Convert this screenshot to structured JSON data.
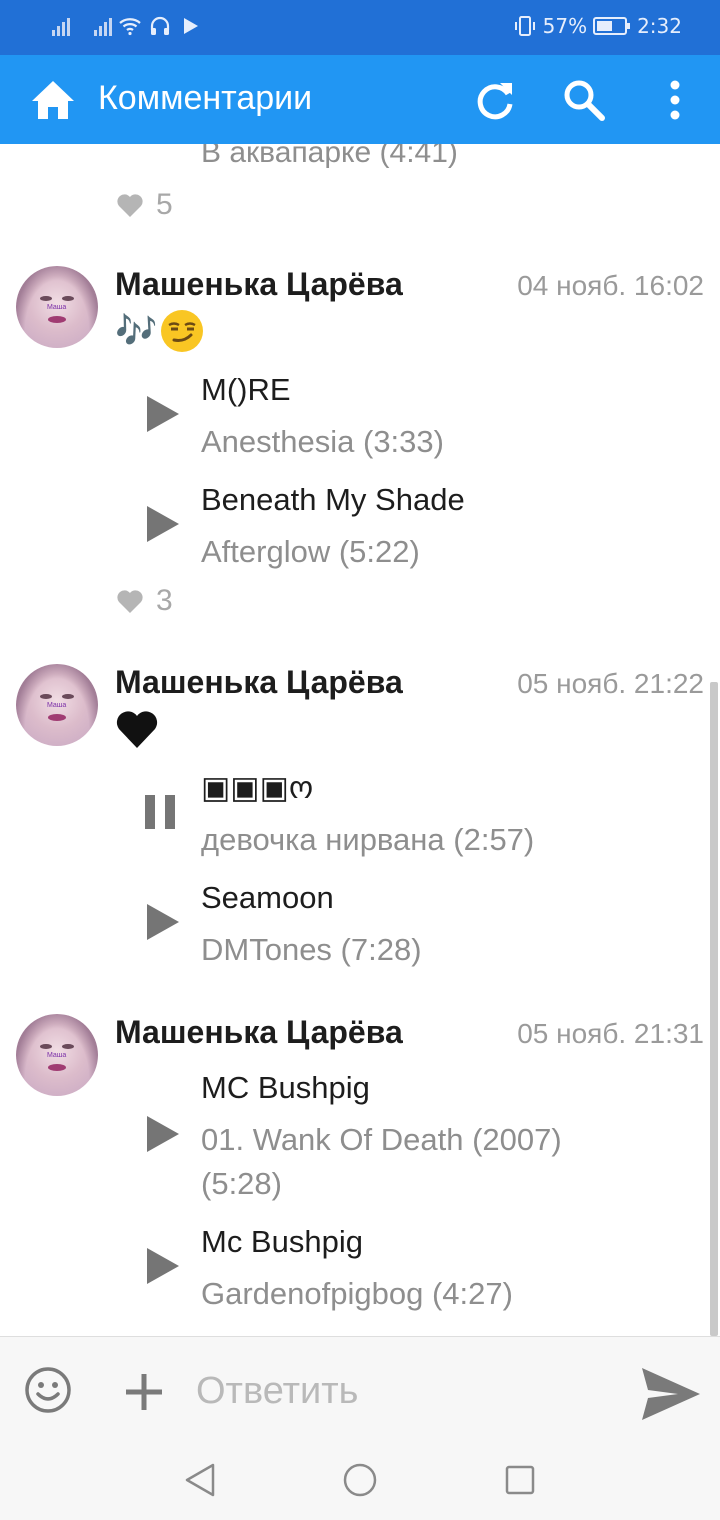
{
  "status_bar": {
    "battery_percent_text": "57%",
    "battery_level": 0.57,
    "time": "2:32"
  },
  "app_bar": {
    "title": "Комментарии",
    "icons": [
      "home-icon",
      "refresh-icon",
      "search-icon",
      "more-vert-icon"
    ]
  },
  "feed": {
    "partial_track_subtitle": "В аквапарке (4:41)",
    "partial_likes": "5",
    "comments": [
      {
        "author": "Машенька Царёва",
        "date": "04 нояб. 16:02",
        "text": "🎶",
        "emoji": "smirk-emoji",
        "tracks": [
          {
            "title": "M()RE",
            "subtitle": "Anesthesia (3:33)",
            "state": "play"
          },
          {
            "title": "Beneath My Shade",
            "subtitle": "Afterglow (5:22)",
            "state": "play"
          }
        ],
        "likes": "3"
      },
      {
        "author": "Машенька Царёва",
        "date": "05 нояб. 21:22",
        "emoji": "black-heart-emoji",
        "tracks": [
          {
            "title": "▣▣▣ო",
            "subtitle": "девочка нирвана (2:57)",
            "state": "pause"
          },
          {
            "title": "Seamoon",
            "subtitle": "DMTones (7:28)",
            "state": "play"
          }
        ]
      },
      {
        "author": "Машенька Царёва",
        "date": "05 нояб. 21:31",
        "tracks": [
          {
            "title": "MC Bushpig",
            "subtitle": "01. Wank Of Death (2007) (5:28)",
            "state": "play"
          },
          {
            "title": "Mc Bushpig",
            "subtitle": "Gardenofpigbog (4:27)",
            "state": "play"
          }
        ]
      }
    ],
    "avatar_label": "Маша"
  },
  "reply": {
    "placeholder": "Ответить",
    "value": ""
  },
  "colors": {
    "status_bar": "#2170d6",
    "app_bar": "#2196f3",
    "text_primary": "#1d1d1d",
    "text_secondary": "#8e8e8e",
    "icon_gray": "#7a7a7a"
  }
}
